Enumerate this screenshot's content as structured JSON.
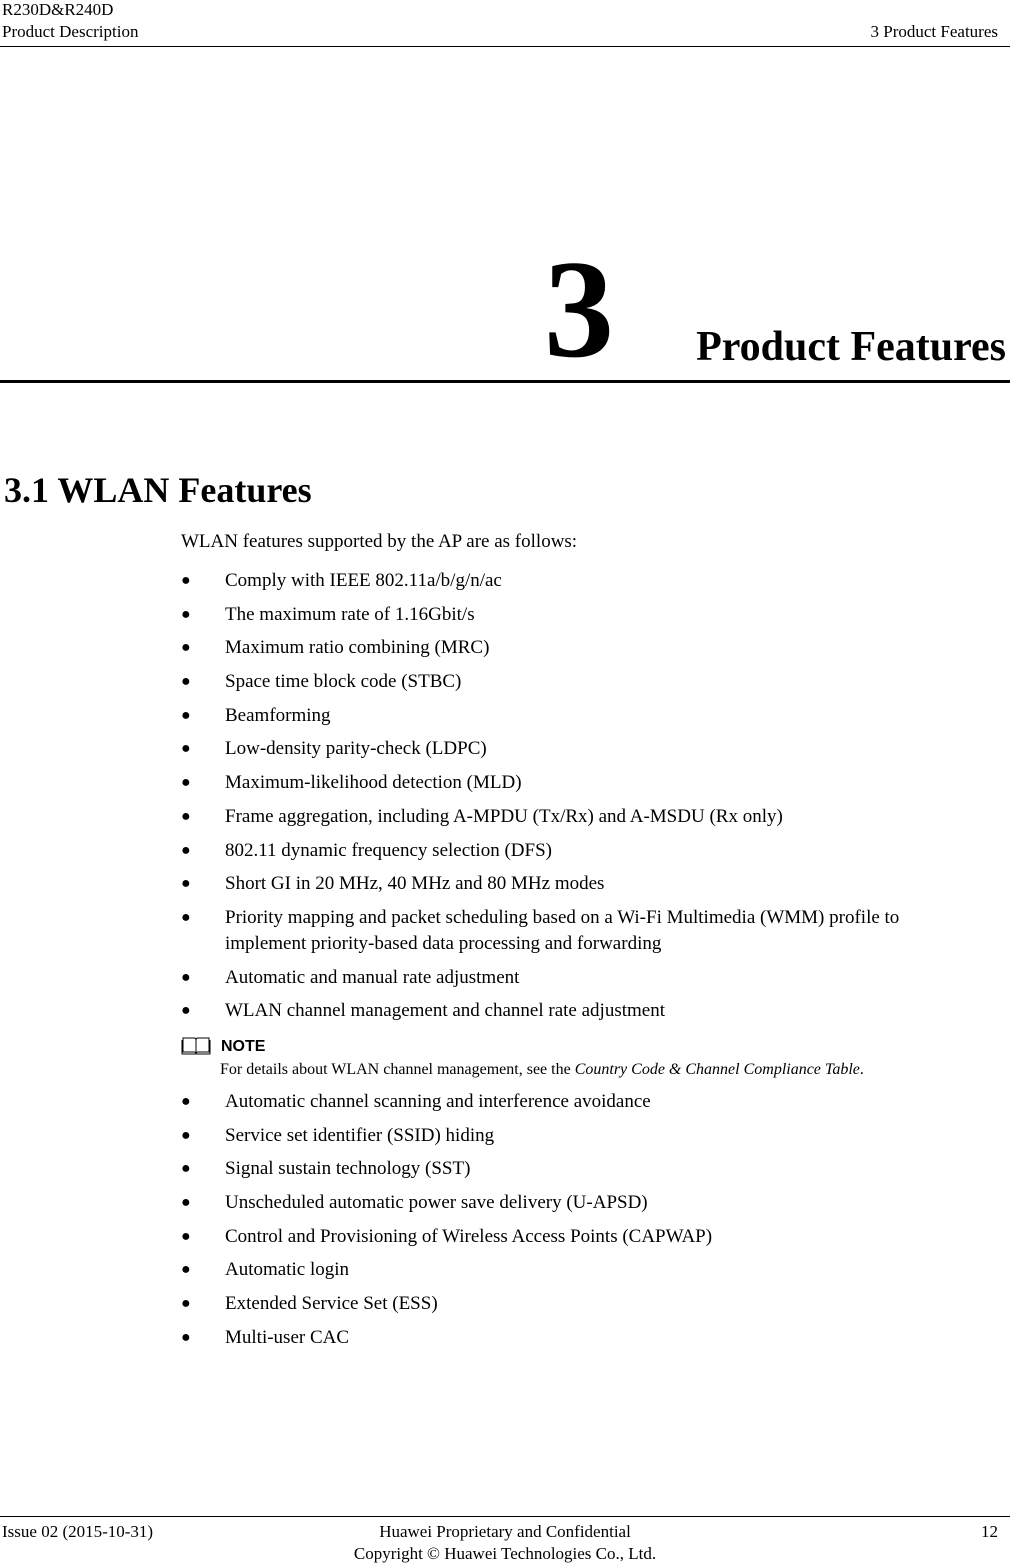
{
  "header": {
    "product": "R230D&R240D",
    "doc_type": "Product Description",
    "chapter_ref": "3 Product Features"
  },
  "chapter": {
    "number": "3",
    "title": "Product Features"
  },
  "section": {
    "title": "3.1 WLAN Features",
    "intro": "WLAN features supported by the AP are as follows:"
  },
  "bullet_glyph": "●",
  "features_part1": [
    "Comply with IEEE 802.11a/b/g/n/ac",
    "The maximum rate of 1.16Gbit/s",
    "Maximum ratio combining (MRC)",
    "Space time block code (STBC)",
    "Beamforming",
    "Low-density parity-check (LDPC)",
    "Maximum-likelihood detection (MLD)",
    "Frame aggregation, including A-MPDU (Tx/Rx) and A-MSDU (Rx only)",
    "802.11 dynamic frequency selection (DFS)",
    "Short GI in 20 MHz, 40 MHz and 80 MHz modes",
    "Priority mapping and packet scheduling based on a Wi-Fi Multimedia (WMM) profile to",
    "Automatic and manual rate adjustment",
    "WLAN channel management and channel rate adjustment"
  ],
  "feature_wrap_line": "implement priority-based data processing and forwarding",
  "note": {
    "icon": "book-icon",
    "label": "NOTE",
    "text_prefix": "For details about WLAN channel management, see the ",
    "text_link": "Country Code & Channel Compliance Table",
    "text_suffix": "."
  },
  "features_part2": [
    "Automatic channel scanning and interference avoidance",
    "Service set identifier (SSID) hiding",
    "Signal sustain technology (SST)",
    "Unscheduled automatic power save delivery (U-APSD)",
    "Control and Provisioning of Wireless Access Points (CAPWAP)",
    "Automatic login",
    "Extended Service Set (ESS)",
    "Multi-user CAC"
  ],
  "footer": {
    "issue": "Issue 02 (2015-10-31)",
    "confidential": "Huawei Proprietary and Confidential",
    "copyright": "Copyright © Huawei Technologies Co., Ltd.",
    "page_number": "12"
  }
}
